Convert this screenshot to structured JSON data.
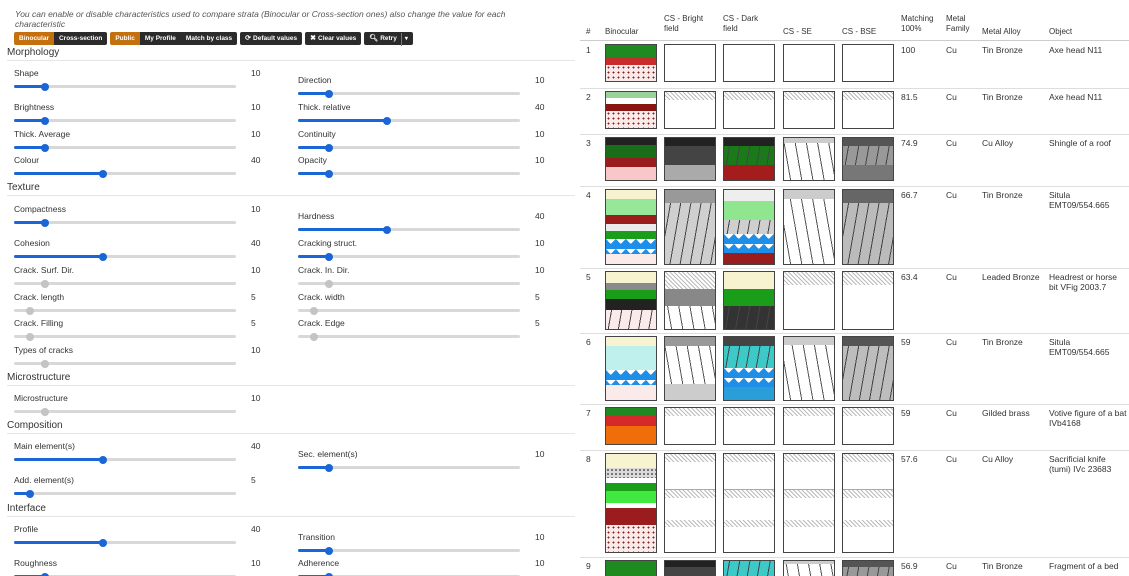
{
  "intro": "You can enable or disable characteristics used to compare strata (Binocular or Cross-section ones) also change the value for each characteristic",
  "toolbar": {
    "binocular": "Binocular",
    "cross_section": "Cross-section",
    "public": "Public",
    "my_profile": "My Profile",
    "match_by_class": "Match by class",
    "default_values": "Default values",
    "clear_values": "Clear values",
    "retry": "Retry"
  },
  "sections": {
    "morphology": "Morphology",
    "texture": "Texture",
    "microstructure": "Microstructure",
    "composition": "Composition",
    "interface": "Interface"
  },
  "sliders": {
    "shape": {
      "label": "Shape",
      "value": "10",
      "fraction": 0.14,
      "enabled": true
    },
    "direction": {
      "label": "Direction",
      "value": "10",
      "fraction": 0.14,
      "enabled": true
    },
    "brightness": {
      "label": "Brightness",
      "value": "10",
      "fraction": 0.14,
      "enabled": true
    },
    "thick_relative": {
      "label": "Thick. relative",
      "value": "40",
      "fraction": 0.4,
      "enabled": true
    },
    "thick_average": {
      "label": "Thick. Average",
      "value": "10",
      "fraction": 0.14,
      "enabled": true
    },
    "continuity": {
      "label": "Continuity",
      "value": "10",
      "fraction": 0.14,
      "enabled": true
    },
    "colour": {
      "label": "Colour",
      "value": "40",
      "fraction": 0.4,
      "enabled": true
    },
    "opacity": {
      "label": "Opacity",
      "value": "10",
      "fraction": 0.14,
      "enabled": true
    },
    "compactness": {
      "label": "Compactness",
      "value": "10",
      "fraction": 0.14,
      "enabled": true
    },
    "hardness": {
      "label": "Hardness",
      "value": "40",
      "fraction": 0.4,
      "enabled": true
    },
    "cohesion": {
      "label": "Cohesion",
      "value": "40",
      "fraction": 0.4,
      "enabled": true
    },
    "cracking_struct": {
      "label": "Cracking struct.",
      "value": "10",
      "fraction": 0.14,
      "enabled": true
    },
    "crack_surf_dir": {
      "label": "Crack. Surf. Dir.",
      "value": "10",
      "fraction": 0.14,
      "enabled": false
    },
    "crack_in_dir": {
      "label": "Crack. In. Dir.",
      "value": "10",
      "fraction": 0.14,
      "enabled": false
    },
    "crack_length": {
      "label": "Crack. length",
      "value": "5",
      "fraction": 0.07,
      "enabled": false
    },
    "crack_width": {
      "label": "Crack. width",
      "value": "5",
      "fraction": 0.07,
      "enabled": false
    },
    "crack_filling": {
      "label": "Crack. Filling",
      "value": "5",
      "fraction": 0.07,
      "enabled": false
    },
    "crack_edge": {
      "label": "Crack. Edge",
      "value": "5",
      "fraction": 0.07,
      "enabled": false
    },
    "types_of_cracks": {
      "label": "Types of cracks",
      "value": "10",
      "fraction": 0.14,
      "enabled": false
    },
    "microstructure": {
      "label": "Microstructure",
      "value": "10",
      "fraction": 0.14,
      "enabled": false
    },
    "main_element": {
      "label": "Main element(s)",
      "value": "40",
      "fraction": 0.4,
      "enabled": true
    },
    "sec_element": {
      "label": "Sec. element(s)",
      "value": "10",
      "fraction": 0.14,
      "enabled": true
    },
    "add_element": {
      "label": "Add. element(s)",
      "value": "5",
      "fraction": 0.07,
      "enabled": true
    },
    "profile": {
      "label": "Profile",
      "value": "40",
      "fraction": 0.4,
      "enabled": true
    },
    "transition": {
      "label": "Transition",
      "value": "10",
      "fraction": 0.14,
      "enabled": true
    },
    "roughness": {
      "label": "Roughness",
      "value": "10",
      "fraction": 0.14,
      "enabled": true
    },
    "adherence": {
      "label": "Adherence",
      "value": "10",
      "fraction": 0.14,
      "enabled": true
    }
  },
  "table": {
    "headers": {
      "num": "#",
      "binocular": "Binocular",
      "cs_bright": "CS - Bright field",
      "cs_dark": "CS - Dark field",
      "cs_se": "CS - SE",
      "cs_bse": "CS - BSE",
      "matching": "Matching 100%",
      "metal_family": "Metal Family",
      "metal_alloy": "Metal Alloy",
      "object": "Object"
    },
    "rows": [
      {
        "num": "1",
        "matching": "100",
        "family": "Cu",
        "alloy": "Tin Bronze",
        "object": "Axe head N11"
      },
      {
        "num": "2",
        "matching": "81.5",
        "family": "Cu",
        "alloy": "Tin Bronze",
        "object": "Axe head N11"
      },
      {
        "num": "3",
        "matching": "74.9",
        "family": "Cu",
        "alloy": "Cu Alloy",
        "object": "Shingle of a roof"
      },
      {
        "num": "4",
        "matching": "66.7",
        "family": "Cu",
        "alloy": "Tin Bronze",
        "object": "Situla EMT09/554.665"
      },
      {
        "num": "5",
        "matching": "63.4",
        "family": "Cu",
        "alloy": "Leaded Bronze",
        "object": "Headrest or horse bit VFig 2003.7"
      },
      {
        "num": "6",
        "matching": "59",
        "family": "Cu",
        "alloy": "Tin Bronze",
        "object": "Situla EMT09/554.665"
      },
      {
        "num": "7",
        "matching": "59",
        "family": "Cu",
        "alloy": "Gilded brass",
        "object": "Votive figure of a bat IVb4168"
      },
      {
        "num": "8",
        "matching": "57.6",
        "family": "Cu",
        "alloy": "Cu Alloy",
        "object": "Sacrificial knife (tumi) IVc 23683"
      },
      {
        "num": "9",
        "matching": "56.9",
        "family": "Cu",
        "alloy": "Tin Bronze",
        "object": "Fragment of a bed"
      }
    ]
  },
  "colors": {
    "accent": "#c4700f",
    "slider": "#1a66d6",
    "dark_button": "#2b2b2b"
  }
}
